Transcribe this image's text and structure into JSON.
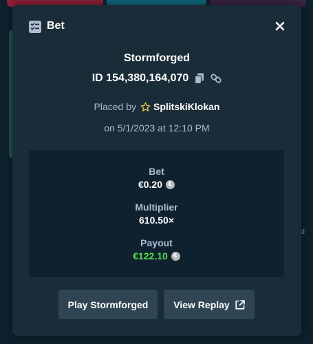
{
  "modal": {
    "title": "Bet",
    "header_icon": "bet-slip-icon",
    "close_icon": "close-icon"
  },
  "bet": {
    "game_name": "Stormforged",
    "id_label": "ID 154,380,164,070",
    "copy_icon": "copy-icon",
    "link_icon": "link-icon",
    "placed_by_label": "Placed by",
    "username": "SplitskiKlokan",
    "vip_icon": "star-icon",
    "date_text": "on 5/1/2023 at 12:10 PM"
  },
  "stats": {
    "bet_label": "Bet",
    "bet_value": "€0.20",
    "multiplier_label": "Multiplier",
    "multiplier_value": "610.50×",
    "payout_label": "Payout",
    "payout_value": "€122.10",
    "currency_icon": "litecoin-icon"
  },
  "actions": {
    "play_label": "Play Stormforged",
    "replay_label": "View Replay",
    "replay_icon": "external-link-icon"
  },
  "colors": {
    "modal_bg": "#1a2c38",
    "panel_bg": "#0f212e",
    "button_bg": "#2f4553",
    "secondary_text": "#b1bad3",
    "payout_green": "#5ddf4f",
    "star_yellow": "#f2c94c"
  }
}
